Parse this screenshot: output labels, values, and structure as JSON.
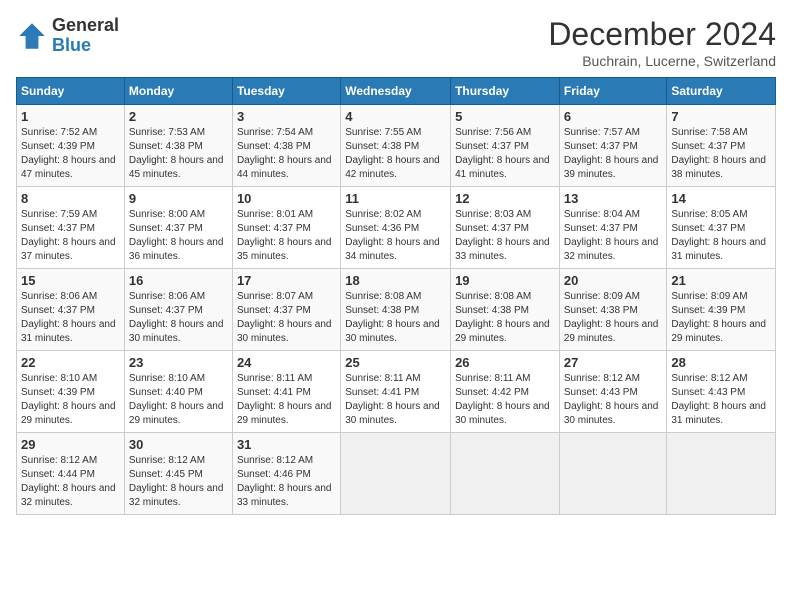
{
  "logo": {
    "general": "General",
    "blue": "Blue"
  },
  "title": "December 2024",
  "location": "Buchrain, Lucerne, Switzerland",
  "weekdays": [
    "Sunday",
    "Monday",
    "Tuesday",
    "Wednesday",
    "Thursday",
    "Friday",
    "Saturday"
  ],
  "weeks": [
    [
      {
        "day": "1",
        "sunrise": "7:52 AM",
        "sunset": "4:39 PM",
        "daylight": "8 hours and 47 minutes."
      },
      {
        "day": "2",
        "sunrise": "7:53 AM",
        "sunset": "4:38 PM",
        "daylight": "8 hours and 45 minutes."
      },
      {
        "day": "3",
        "sunrise": "7:54 AM",
        "sunset": "4:38 PM",
        "daylight": "8 hours and 44 minutes."
      },
      {
        "day": "4",
        "sunrise": "7:55 AM",
        "sunset": "4:38 PM",
        "daylight": "8 hours and 42 minutes."
      },
      {
        "day": "5",
        "sunrise": "7:56 AM",
        "sunset": "4:37 PM",
        "daylight": "8 hours and 41 minutes."
      },
      {
        "day": "6",
        "sunrise": "7:57 AM",
        "sunset": "4:37 PM",
        "daylight": "8 hours and 39 minutes."
      },
      {
        "day": "7",
        "sunrise": "7:58 AM",
        "sunset": "4:37 PM",
        "daylight": "8 hours and 38 minutes."
      }
    ],
    [
      {
        "day": "8",
        "sunrise": "7:59 AM",
        "sunset": "4:37 PM",
        "daylight": "8 hours and 37 minutes."
      },
      {
        "day": "9",
        "sunrise": "8:00 AM",
        "sunset": "4:37 PM",
        "daylight": "8 hours and 36 minutes."
      },
      {
        "day": "10",
        "sunrise": "8:01 AM",
        "sunset": "4:37 PM",
        "daylight": "8 hours and 35 minutes."
      },
      {
        "day": "11",
        "sunrise": "8:02 AM",
        "sunset": "4:36 PM",
        "daylight": "8 hours and 34 minutes."
      },
      {
        "day": "12",
        "sunrise": "8:03 AM",
        "sunset": "4:37 PM",
        "daylight": "8 hours and 33 minutes."
      },
      {
        "day": "13",
        "sunrise": "8:04 AM",
        "sunset": "4:37 PM",
        "daylight": "8 hours and 32 minutes."
      },
      {
        "day": "14",
        "sunrise": "8:05 AM",
        "sunset": "4:37 PM",
        "daylight": "8 hours and 31 minutes."
      }
    ],
    [
      {
        "day": "15",
        "sunrise": "8:06 AM",
        "sunset": "4:37 PM",
        "daylight": "8 hours and 31 minutes."
      },
      {
        "day": "16",
        "sunrise": "8:06 AM",
        "sunset": "4:37 PM",
        "daylight": "8 hours and 30 minutes."
      },
      {
        "day": "17",
        "sunrise": "8:07 AM",
        "sunset": "4:37 PM",
        "daylight": "8 hours and 30 minutes."
      },
      {
        "day": "18",
        "sunrise": "8:08 AM",
        "sunset": "4:38 PM",
        "daylight": "8 hours and 30 minutes."
      },
      {
        "day": "19",
        "sunrise": "8:08 AM",
        "sunset": "4:38 PM",
        "daylight": "8 hours and 29 minutes."
      },
      {
        "day": "20",
        "sunrise": "8:09 AM",
        "sunset": "4:38 PM",
        "daylight": "8 hours and 29 minutes."
      },
      {
        "day": "21",
        "sunrise": "8:09 AM",
        "sunset": "4:39 PM",
        "daylight": "8 hours and 29 minutes."
      }
    ],
    [
      {
        "day": "22",
        "sunrise": "8:10 AM",
        "sunset": "4:39 PM",
        "daylight": "8 hours and 29 minutes."
      },
      {
        "day": "23",
        "sunrise": "8:10 AM",
        "sunset": "4:40 PM",
        "daylight": "8 hours and 29 minutes."
      },
      {
        "day": "24",
        "sunrise": "8:11 AM",
        "sunset": "4:41 PM",
        "daylight": "8 hours and 29 minutes."
      },
      {
        "day": "25",
        "sunrise": "8:11 AM",
        "sunset": "4:41 PM",
        "daylight": "8 hours and 30 minutes."
      },
      {
        "day": "26",
        "sunrise": "8:11 AM",
        "sunset": "4:42 PM",
        "daylight": "8 hours and 30 minutes."
      },
      {
        "day": "27",
        "sunrise": "8:12 AM",
        "sunset": "4:43 PM",
        "daylight": "8 hours and 30 minutes."
      },
      {
        "day": "28",
        "sunrise": "8:12 AM",
        "sunset": "4:43 PM",
        "daylight": "8 hours and 31 minutes."
      }
    ],
    [
      {
        "day": "29",
        "sunrise": "8:12 AM",
        "sunset": "4:44 PM",
        "daylight": "8 hours and 32 minutes."
      },
      {
        "day": "30",
        "sunrise": "8:12 AM",
        "sunset": "4:45 PM",
        "daylight": "8 hours and 32 minutes."
      },
      {
        "day": "31",
        "sunrise": "8:12 AM",
        "sunset": "4:46 PM",
        "daylight": "8 hours and 33 minutes."
      },
      null,
      null,
      null,
      null
    ]
  ]
}
